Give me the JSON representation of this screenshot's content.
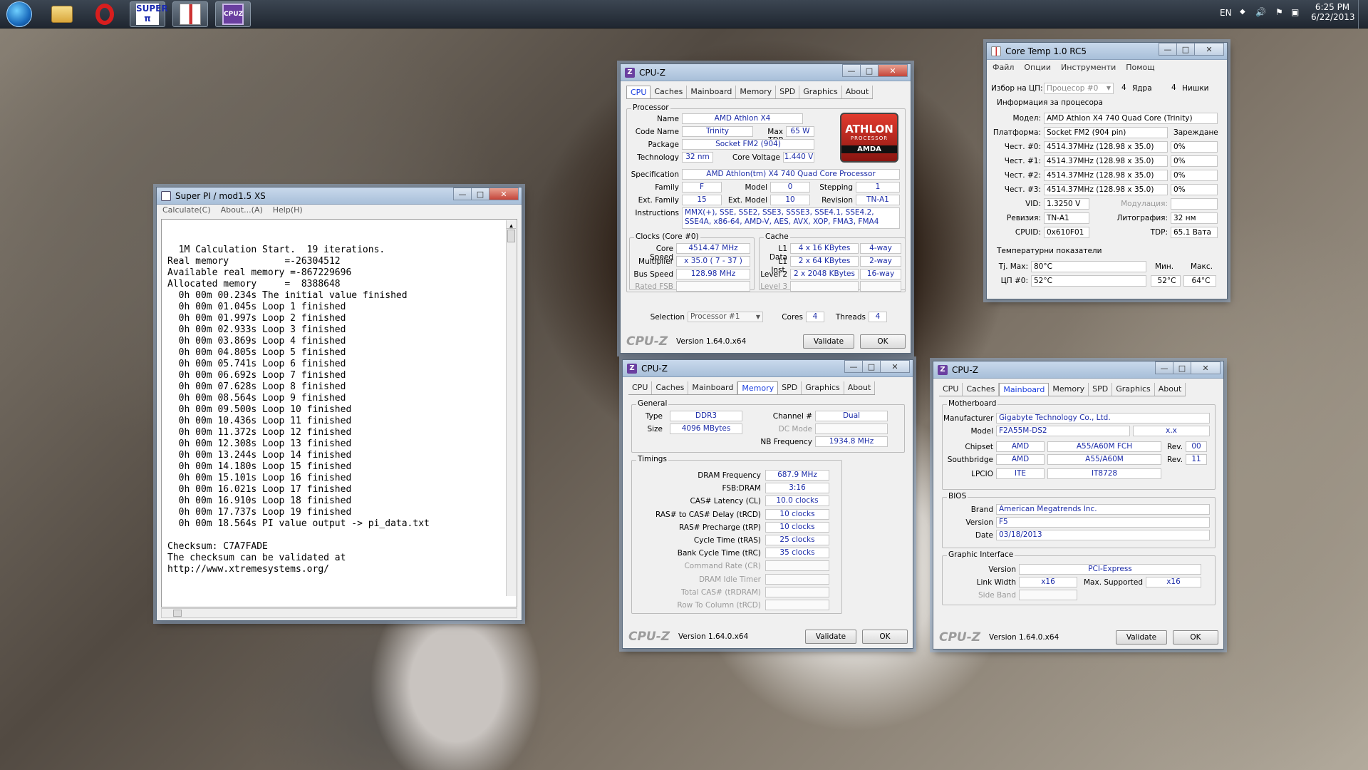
{
  "taskbar": {
    "apps": [
      "start-orb",
      "windows-explorer",
      "opera",
      "super-pi",
      "coretemp",
      "cpu-z"
    ],
    "lang": "EN",
    "time": "6:25 PM",
    "date": "6/22/2013"
  },
  "superpi": {
    "title": "Super PI / mod1.5 XS",
    "menu": [
      "Calculate(C)",
      "About...(A)",
      "Help(H)"
    ],
    "lines": [
      "  1M Calculation Start.  19 iterations.",
      "Real memory          =-26304512",
      "Available real memory =-867229696",
      "Allocated memory     =  8388648",
      "  0h 00m 00.234s The initial value finished",
      "  0h 00m 01.045s Loop 1 finished",
      "  0h 00m 01.997s Loop 2 finished",
      "  0h 00m 02.933s Loop 3 finished",
      "  0h 00m 03.869s Loop 4 finished",
      "  0h 00m 04.805s Loop 5 finished",
      "  0h 00m 05.741s Loop 6 finished",
      "  0h 00m 06.692s Loop 7 finished",
      "  0h 00m 07.628s Loop 8 finished",
      "  0h 00m 08.564s Loop 9 finished",
      "  0h 00m 09.500s Loop 10 finished",
      "  0h 00m 10.436s Loop 11 finished",
      "  0h 00m 11.372s Loop 12 finished",
      "  0h 00m 12.308s Loop 13 finished",
      "  0h 00m 13.244s Loop 14 finished",
      "  0h 00m 14.180s Loop 15 finished",
      "  0h 00m 15.101s Loop 16 finished",
      "  0h 00m 16.021s Loop 17 finished",
      "  0h 00m 16.910s Loop 18 finished",
      "  0h 00m 17.737s Loop 19 finished",
      "  0h 00m 18.564s PI value output -> pi_data.txt",
      "",
      "Checksum: C7A7FADE",
      "The checksum can be validated at",
      "http://www.xtremesystems.org/"
    ]
  },
  "cpuz_tabs": [
    "CPU",
    "Caches",
    "Mainboard",
    "Memory",
    "SPD",
    "Graphics",
    "About"
  ],
  "cpuz_common": {
    "title": "CPU-Z",
    "logo": "CPU-Z",
    "version": "Version 1.64.0.x64",
    "validate": "Validate",
    "ok": "OK"
  },
  "cpu": {
    "group_processor": "Processor",
    "name_lbl": "Name",
    "name": "AMD Athlon X4",
    "codename_lbl": "Code Name",
    "codename": "Trinity",
    "maxtdp_lbl": "Max TDP",
    "maxtdp": "65 W",
    "package_lbl": "Package",
    "package": "Socket FM2 (904)",
    "tech_lbl": "Technology",
    "tech": "32 nm",
    "voltage_lbl": "Core Voltage",
    "voltage": "1.440 V",
    "spec_lbl": "Specification",
    "spec": "AMD Athlon(tm) X4 740 Quad Core Processor",
    "family_lbl": "Family",
    "family": "F",
    "model_lbl": "Model",
    "model": "0",
    "stepping_lbl": "Stepping",
    "stepping": "1",
    "extfamily_lbl": "Ext. Family",
    "extfamily": "15",
    "extmodel_lbl": "Ext. Model",
    "extmodel": "10",
    "revision_lbl": "Revision",
    "revision": "TN-A1",
    "instr_lbl": "Instructions",
    "instr": "MMX(+), SSE, SSE2, SSE3, SSSE3, SSE4.1, SSE4.2, SSE4A, x86-64, AMD-V, AES, AVX, XOP, FMA3, FMA4",
    "group_clocks": "Clocks (Core #0)",
    "corespeed_lbl": "Core Speed",
    "corespeed": "4514.47 MHz",
    "mult_lbl": "Multiplier",
    "mult": "x 35.0 ( 7 - 37 )",
    "bus_lbl": "Bus Speed",
    "bus": "128.98 MHz",
    "fsb_lbl": "Rated FSB",
    "group_cache": "Cache",
    "l1d_lbl": "L1 Data",
    "l1d": "4 x 16 KBytes",
    "l1d_w": "4-way",
    "l1i_lbl": "L1 Inst.",
    "l1i": "2 x 64 KBytes",
    "l1i_w": "2-way",
    "l2_lbl": "Level 2",
    "l2": "2 x 2048 KBytes",
    "l2_w": "16-way",
    "l3_lbl": "Level 3",
    "sel_lbl": "Selection",
    "sel": "Processor #1",
    "cores_lbl": "Cores",
    "cores": "4",
    "threads_lbl": "Threads",
    "threads": "4",
    "logo_top": "ATHLON",
    "logo_mid": "PROCESSOR",
    "logo_bot": "AMDA"
  },
  "memory": {
    "group_general": "General",
    "type_lbl": "Type",
    "type": "DDR3",
    "channel_lbl": "Channel #",
    "channel": "Dual",
    "size_lbl": "Size",
    "size": "4096 MBytes",
    "dcmode_lbl": "DC Mode",
    "nbfreq_lbl": "NB Frequency",
    "nbfreq": "1934.8 MHz",
    "group_timings": "Timings",
    "dram_lbl": "DRAM Frequency",
    "dram": "687.9 MHz",
    "fsbdram_lbl": "FSB:DRAM",
    "fsbdram": "3:16",
    "cl_lbl": "CAS# Latency (CL)",
    "cl": "10.0 clocks",
    "trcd_lbl": "RAS# to CAS# Delay (tRCD)",
    "trcd": "10 clocks",
    "trp_lbl": "RAS# Precharge (tRP)",
    "trp": "10 clocks",
    "tras_lbl": "Cycle Time (tRAS)",
    "tras": "25 clocks",
    "trc_lbl": "Bank Cycle Time (tRC)",
    "trc": "35 clocks",
    "cr_lbl": "Command Rate (CR)",
    "idle_lbl": "DRAM Idle Timer",
    "trdram_lbl": "Total CAS# (tRDRAM)",
    "trcd2_lbl": "Row To Column (tRCD)"
  },
  "mainboard": {
    "group_mb": "Motherboard",
    "manu_lbl": "Manufacturer",
    "manu": "Gigabyte Technology Co., Ltd.",
    "model_lbl": "Model",
    "model": "F2A55M-DS2",
    "model_rev": "x.x",
    "chipset_lbl": "Chipset",
    "chipset": "AMD",
    "chipset2": "A55/A60M FCH",
    "rev_lbl": "Rev.",
    "chipset_rev": "00",
    "sb_lbl": "Southbridge",
    "sb": "AMD",
    "sb2": "A55/A60M",
    "sb_rev": "11",
    "lpcio_lbl": "LPCIO",
    "lpcio": "ITE",
    "lpcio2": "IT8728",
    "group_bios": "BIOS",
    "brand_lbl": "Brand",
    "brand": "American Megatrends Inc.",
    "ver_lbl": "Version",
    "ver": "F5",
    "date_lbl": "Date",
    "date": "03/18/2013",
    "group_gi": "Graphic Interface",
    "giver_lbl": "Version",
    "giver": "PCI-Express",
    "lw_lbl": "Link Width",
    "lw": "x16",
    "maxs_lbl": "Max. Supported",
    "maxs": "x16",
    "sideband_lbl": "Side Band"
  },
  "coretemp": {
    "title": "Core Temp 1.0 RC5",
    "menu": [
      "Файл",
      "Опции",
      "Инструменти",
      "Помощ"
    ],
    "sel_lbl": "Избор на ЦП:",
    "sel": "Процесор #0",
    "cores": "4",
    "cores_lbl": "Ядра",
    "threads": "4",
    "threads_lbl": "Нишки",
    "info_lbl": "Информация за процесора",
    "model_lbl": "Модел:",
    "model": "AMD Athlon X4 740 Quad Core (Trinity)",
    "platform_lbl": "Платформа:",
    "platform": "Socket FM2 (904 pin)",
    "load_lbl": "Зареждане",
    "freqs": [
      {
        "lbl": "Чест. #0:",
        "val": "4514.37MHz (128.98 x 35.0)",
        "load": "0%"
      },
      {
        "lbl": "Чест. #1:",
        "val": "4514.37MHz (128.98 x 35.0)",
        "load": "0%"
      },
      {
        "lbl": "Чест. #2:",
        "val": "4514.37MHz (128.98 x 35.0)",
        "load": "0%"
      },
      {
        "lbl": "Чест. #3:",
        "val": "4514.37MHz (128.98 x 35.0)",
        "load": "0%"
      }
    ],
    "vid_lbl": "VID:",
    "vid": "1.3250 V",
    "mod_lbl": "Модулация:",
    "rev_lbl": "Ревизия:",
    "rev": "TN-A1",
    "litho_lbl": "Литография:",
    "litho": "32 нм",
    "cpuid_lbl": "CPUID:",
    "cpuid": "0x610F01",
    "tdp_lbl": "TDP:",
    "tdp": "65.1 Вата",
    "temps_lbl": "Температурни показатели",
    "tjmax_lbl": "Tj. Max:",
    "tjmax": "80°C",
    "min_lbl": "Мин.",
    "max_lbl": "Макс.",
    "cpu0_lbl": "ЦП #0:",
    "cpu0": "52°C",
    "cpu0_min": "52°C",
    "cpu0_max": "64°C"
  }
}
